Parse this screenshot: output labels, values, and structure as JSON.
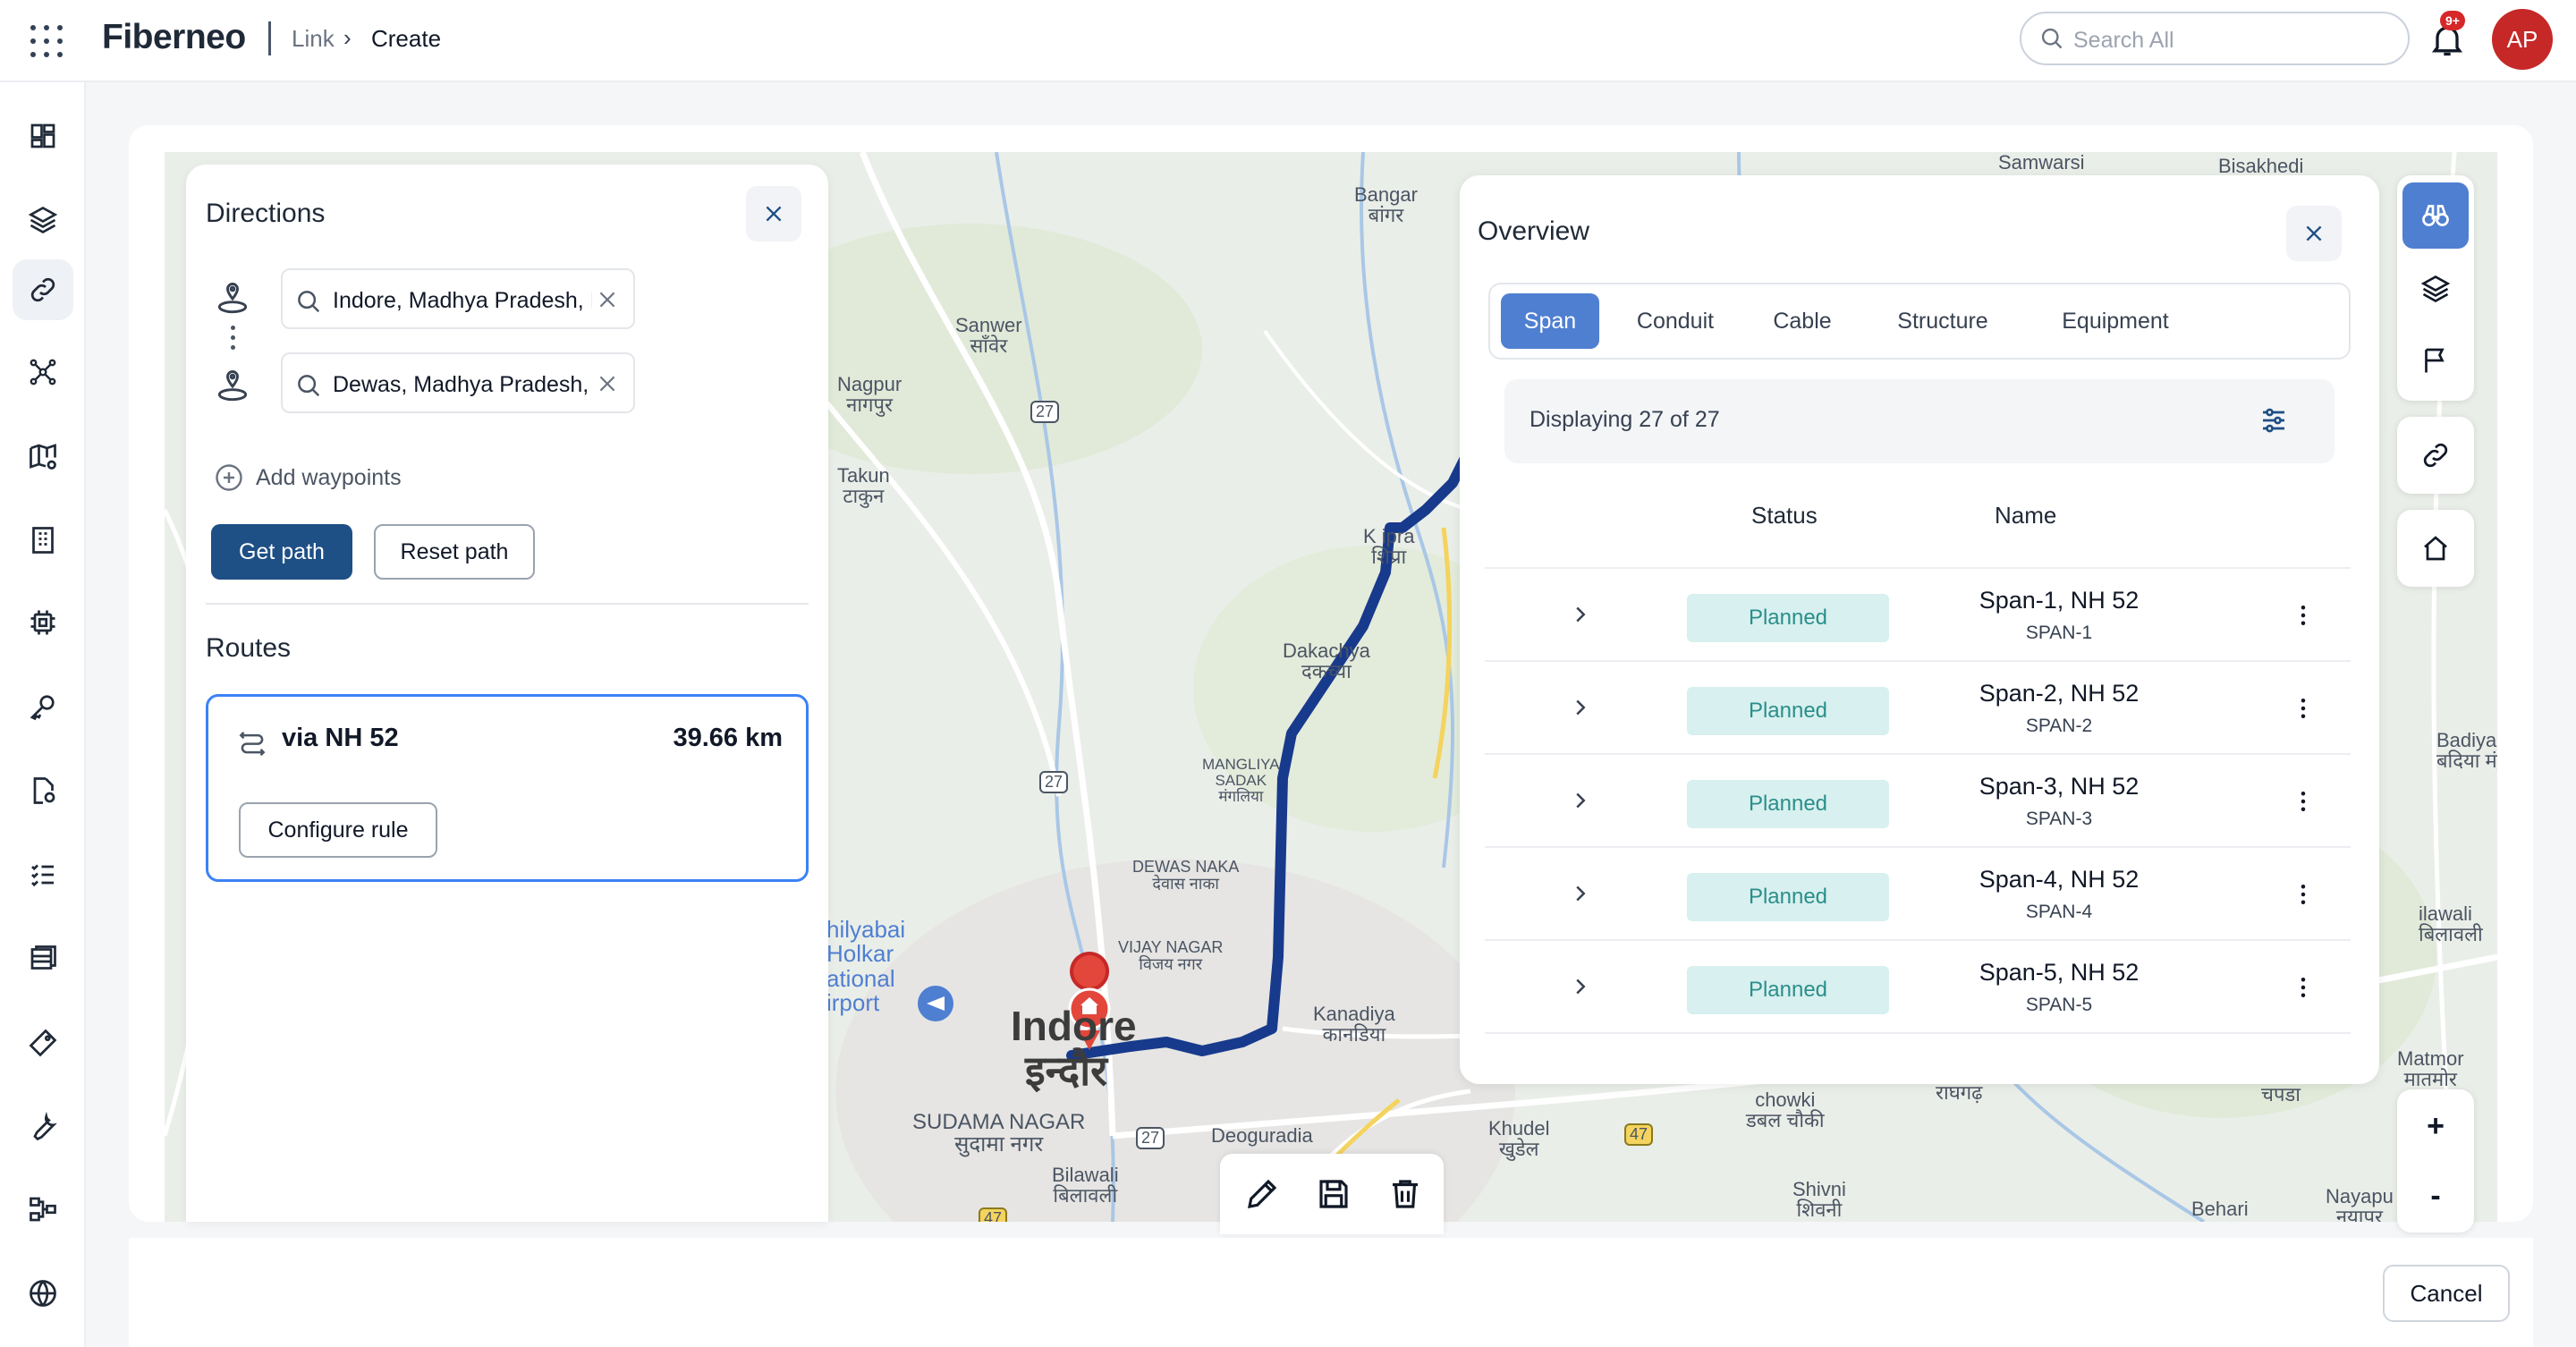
{
  "header": {
    "logo": "Fiberneo",
    "breadcrumb": [
      "Link",
      "Create"
    ],
    "search_placeholder": "Search All",
    "notification_badge": "9+",
    "avatar_initials": "AP"
  },
  "sidebar": {
    "items": [
      {
        "icon": "dashboard-icon"
      },
      {
        "icon": "layers-icon"
      },
      {
        "icon": "link-icon",
        "active": true
      },
      {
        "icon": "network-nodes-icon"
      },
      {
        "icon": "map-settings-icon"
      },
      {
        "icon": "building-icon"
      },
      {
        "icon": "chip-icon"
      },
      {
        "icon": "key-icon"
      },
      {
        "icon": "document-settings-icon"
      },
      {
        "icon": "checklist-icon"
      },
      {
        "icon": "inventory-icon"
      },
      {
        "icon": "tag-icon"
      },
      {
        "icon": "wrench-icon"
      },
      {
        "icon": "hierarchy-icon"
      },
      {
        "icon": "globe-icon"
      }
    ]
  },
  "directions": {
    "title": "Directions",
    "origin": "Indore, Madhya Pradesh, India",
    "destination": "Dewas, Madhya Pradesh, India",
    "add_waypoints": "Add waypoints",
    "get_path": "Get path",
    "reset_path": "Reset path",
    "routes_title": "Routes",
    "route": {
      "name": "via NH 52",
      "distance": "39.66 km",
      "configure": "Configure rule"
    }
  },
  "overview": {
    "title": "Overview",
    "tabs": [
      "Span",
      "Conduit",
      "Cable",
      "Structure",
      "Equipment"
    ],
    "active_tab": "Span",
    "displaying": "Displaying 27 of 27",
    "columns": [
      "Status",
      "Name"
    ],
    "rows": [
      {
        "status": "Planned",
        "name": "Span-1, NH 52",
        "code": "SPAN-1"
      },
      {
        "status": "Planned",
        "name": "Span-2, NH 52",
        "code": "SPAN-2"
      },
      {
        "status": "Planned",
        "name": "Span-3, NH 52",
        "code": "SPAN-3"
      },
      {
        "status": "Planned",
        "name": "Span-4, NH 52",
        "code": "SPAN-4"
      },
      {
        "status": "Planned",
        "name": "Span-5, NH 52",
        "code": "SPAN-5"
      }
    ]
  },
  "map": {
    "labels": {
      "bangar": "Bangar\nबांगर",
      "sanwer": "Sanwer\nसाँवेर",
      "nagpur": "Nagpur\nनागपुर",
      "takun": "Takun\nटाकुन",
      "samwarsi": "Samwarsi",
      "bisakhedi": "Bisakhedi",
      "kshipra": "K ipra\nशिप्रा",
      "dakachya": "Dakachya\nदकच्या",
      "mangliya": "MANGLIYA\nSADAK\nमंगलिया",
      "dewas_naka": "DEWAS NAKA\nदेवास नाका",
      "vijay_nagar": "VIJAY NAGAR\nविजय नगर",
      "ahilyabai": "hilyabai\nHolkar\national\nirport",
      "indore_en": "Indore",
      "indore_hi": "इन्दौर",
      "sudama": "SUDAMA NAGAR\nसुदामा नगर",
      "bilawali": "Bilawali\nबिलावली",
      "deoguradia": "Deoguradia",
      "kanadiya": "Kanadiya\nकानडिया",
      "khudel": "Khudel\nखुडेल",
      "dabal_chowki": "chowki\nडबल चौकी",
      "shivni": "Shivni\nशिवनी",
      "behari": "Behari",
      "badiya": "Badiya Mar\nबदिया मंडु",
      "bilawali2": "ilawali\nबिलावली",
      "matmor": "Matmor\nमातमोर",
      "nayapura": "Nayapu\nनयापुर",
      "rajgarh": "राघगढ़",
      "chapda": "चपडा"
    },
    "road_shields": [
      "27",
      "27",
      "27",
      "47",
      "47"
    ]
  },
  "map_tools": {
    "zoom_in": "+",
    "zoom_out": "-"
  },
  "footer": {
    "cancel": "Cancel"
  },
  "colors": {
    "primary": "#1e4f85",
    "accent": "#4f7fd1",
    "route_line": "#183a8c",
    "planned_bg": "#d8f0ef",
    "planned_text": "#2a8f8a",
    "avatar": "#c62828"
  }
}
